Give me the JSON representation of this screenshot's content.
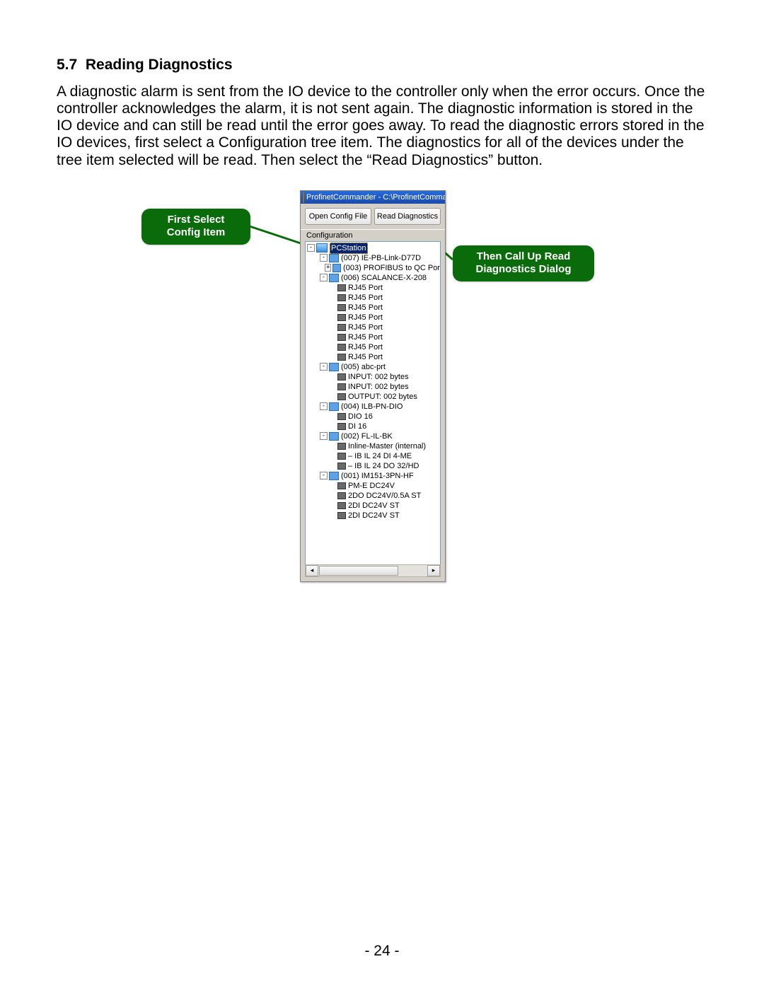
{
  "doc": {
    "heading_number": "5.7",
    "heading_title": "Reading Diagnostics",
    "paragraph": "A diagnostic alarm is sent from the IO device to the controller only when the error occurs. Once the controller acknowledges the alarm, it is not sent again. The diagnostic information is stored in the IO device and can still be read until the error goes away. To read the diagnostic errors stored in the IO devices, first select a Configuration tree item. The diagnostics for all of the devices under the tree item selected will be read. Then select the “Read Diagnostics” button.",
    "page_number": "- 24 -"
  },
  "callouts": {
    "first": "First Select\nConfig Item",
    "second": "Then Call Up Read\nDiagnostics Dialog"
  },
  "win": {
    "title": "ProfinetCommander - C:\\ProfinetCommande",
    "buttons": {
      "open": "Open Config File",
      "read": "Read Diagnostics"
    },
    "section_label": "Configuration",
    "tree": {
      "root": "PCStation",
      "nodes": [
        {
          "depth": 1,
          "exp": "-",
          "icon": "dev",
          "label": "(007) IE-PB-Link-D77D"
        },
        {
          "depth": 2,
          "exp": "+",
          "icon": "dev",
          "label": "(003) PROFIBUS to QC Por"
        },
        {
          "depth": 1,
          "exp": "-",
          "icon": "dev",
          "label": "(006) SCALANCE-X-208"
        },
        {
          "depth": 2,
          "exp": "",
          "icon": "mod",
          "label": "RJ45 Port"
        },
        {
          "depth": 2,
          "exp": "",
          "icon": "mod",
          "label": "RJ45 Port"
        },
        {
          "depth": 2,
          "exp": "",
          "icon": "mod",
          "label": "RJ45 Port"
        },
        {
          "depth": 2,
          "exp": "",
          "icon": "mod",
          "label": "RJ45 Port"
        },
        {
          "depth": 2,
          "exp": "",
          "icon": "mod",
          "label": "RJ45 Port"
        },
        {
          "depth": 2,
          "exp": "",
          "icon": "mod",
          "label": "RJ45 Port"
        },
        {
          "depth": 2,
          "exp": "",
          "icon": "mod",
          "label": "RJ45 Port"
        },
        {
          "depth": 2,
          "exp": "",
          "icon": "mod",
          "label": "RJ45 Port"
        },
        {
          "depth": 1,
          "exp": "-",
          "icon": "dev",
          "label": "(005) abc-prt"
        },
        {
          "depth": 2,
          "exp": "",
          "icon": "mod",
          "label": "INPUT: 002 bytes"
        },
        {
          "depth": 2,
          "exp": "",
          "icon": "mod",
          "label": "INPUT: 002 bytes"
        },
        {
          "depth": 2,
          "exp": "",
          "icon": "mod",
          "label": "OUTPUT: 002 bytes"
        },
        {
          "depth": 1,
          "exp": "-",
          "icon": "dev",
          "label": "(004) ILB-PN-DIO"
        },
        {
          "depth": 2,
          "exp": "",
          "icon": "mod",
          "label": "DIO 16"
        },
        {
          "depth": 2,
          "exp": "",
          "icon": "mod",
          "label": "DI 16"
        },
        {
          "depth": 1,
          "exp": "-",
          "icon": "dev",
          "label": "(002) FL-IL-BK"
        },
        {
          "depth": 2,
          "exp": "",
          "icon": "mod",
          "label": "Inline-Master (internal)"
        },
        {
          "depth": 2,
          "exp": "",
          "icon": "mod",
          "label": "– IB IL 24 DI 4-ME"
        },
        {
          "depth": 2,
          "exp": "",
          "icon": "mod",
          "label": "– IB IL 24 DO 32/HD"
        },
        {
          "depth": 1,
          "exp": "-",
          "icon": "dev",
          "label": "(001) IM151-3PN-HF"
        },
        {
          "depth": 2,
          "exp": "",
          "icon": "mod",
          "label": "PM-E DC24V"
        },
        {
          "depth": 2,
          "exp": "",
          "icon": "mod",
          "label": "2DO DC24V/0.5A ST"
        },
        {
          "depth": 2,
          "exp": "",
          "icon": "mod",
          "label": "2DI DC24V ST"
        },
        {
          "depth": 2,
          "exp": "",
          "icon": "mod",
          "label": "2DI DC24V ST"
        }
      ]
    }
  }
}
